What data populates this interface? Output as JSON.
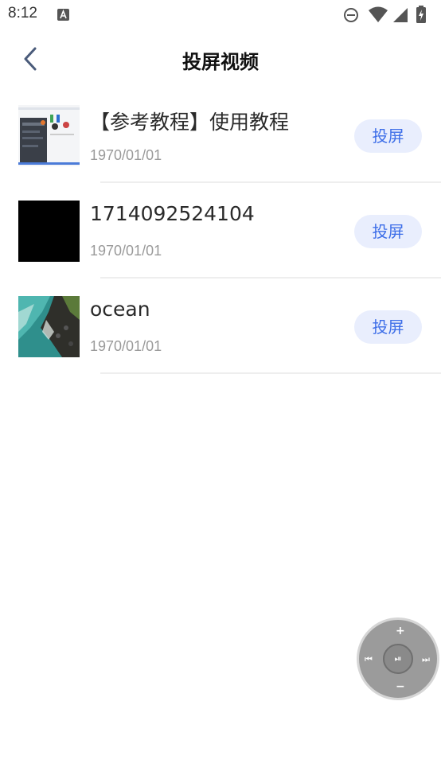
{
  "status_bar": {
    "time": "8:12"
  },
  "header": {
    "title": "投屏视频"
  },
  "videos": [
    {
      "title": "【参考教程】使用教程",
      "date": "1970/01/01",
      "cast_label": "投屏"
    },
    {
      "title": "1714092524104",
      "date": "1970/01/01",
      "cast_label": "投屏"
    },
    {
      "title": "ocean",
      "date": "1970/01/01",
      "cast_label": "投屏"
    }
  ],
  "remote": {
    "volume_up": "+",
    "volume_down": "−",
    "prev": "⏮",
    "next": "⏭",
    "play_pause": "⏯"
  },
  "colors": {
    "accent": "#3d6ee8",
    "button_bg": "#e9eefd"
  }
}
